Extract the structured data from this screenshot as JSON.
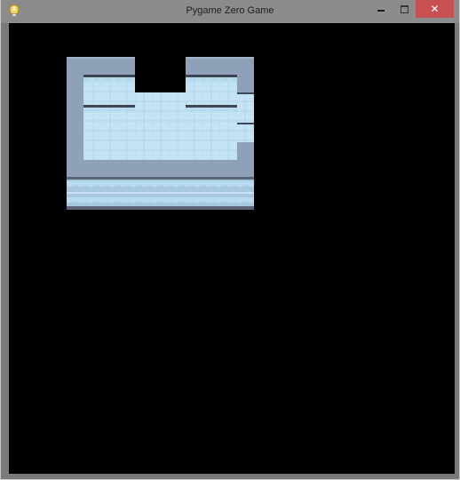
{
  "window": {
    "title": "Pygame Zero Game",
    "close_glyph": "✕"
  },
  "icons": {
    "app": "pygame-zero-icon",
    "minimize": "minimize-icon",
    "maximize": "maximize-icon",
    "close": "close-icon"
  },
  "colors": {
    "titlebar": "#8c8c8c",
    "close_button": "#c75050",
    "game_background": "#000000",
    "wall": "#8ea1b8",
    "floor_tile": "#bfe0f3",
    "ledge": "#3d4652"
  }
}
